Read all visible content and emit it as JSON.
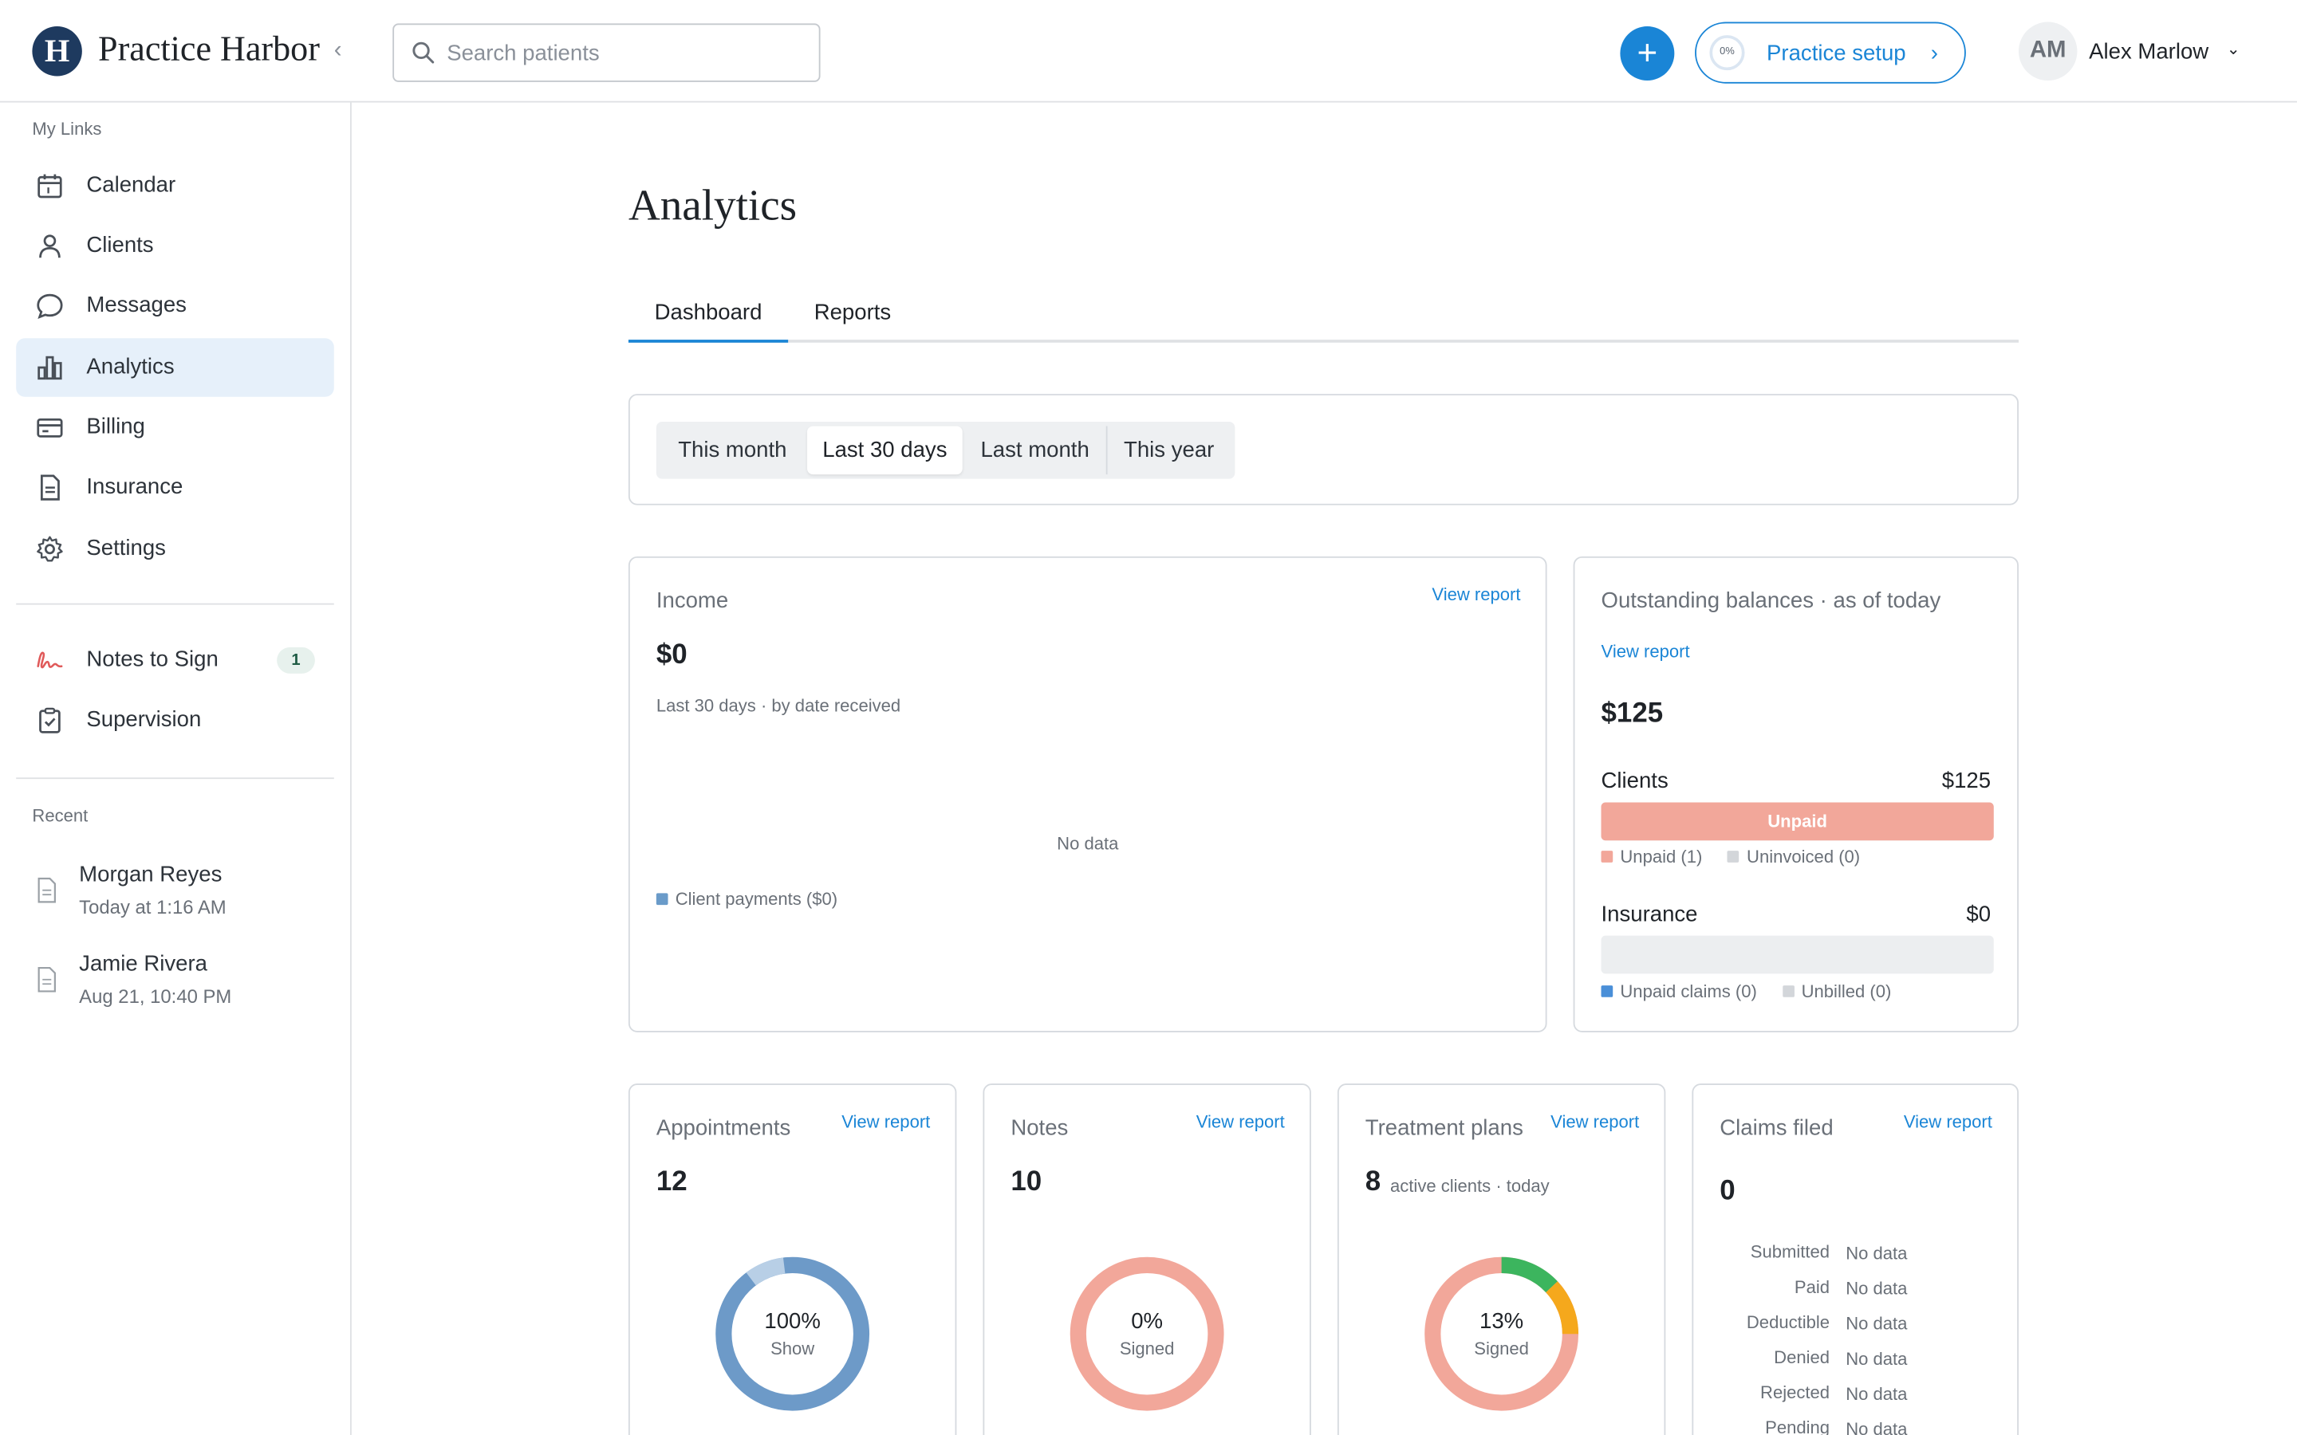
{
  "app": {
    "brand": "Practice Harbor",
    "logo_letter": "H",
    "collapse_glyph": "‹",
    "search_placeholder": "Search patients",
    "plus_glyph": "+",
    "setup_progress": "0%",
    "setup_label": "Practice setup",
    "setup_chevron": "›",
    "user_initials": "AM",
    "user_name": "Alex Marlow",
    "user_chevron": "⌄"
  },
  "sidebar": {
    "my_links_label": "My Links",
    "items": [
      {
        "label": "Calendar",
        "icon": "calendar-icon"
      },
      {
        "label": "Clients",
        "icon": "person-icon"
      },
      {
        "label": "Messages",
        "icon": "chat-icon"
      },
      {
        "label": "Analytics",
        "icon": "bar-chart-icon",
        "active": true
      },
      {
        "label": "Billing",
        "icon": "card-icon"
      },
      {
        "label": "Insurance",
        "icon": "document-icon"
      },
      {
        "label": "Settings",
        "icon": "gear-icon"
      }
    ],
    "secondary": [
      {
        "label": "Notes to Sign",
        "icon": "signature-icon",
        "badge": "1"
      },
      {
        "label": "Supervision",
        "icon": "clipboard-check-icon"
      }
    ],
    "recent_label": "Recent",
    "recent": [
      {
        "name": "Morgan Reyes",
        "time": "Today at 1:16 AM"
      },
      {
        "name": "Jamie Rivera",
        "time": "Aug 21, 10:40 PM"
      }
    ]
  },
  "main": {
    "title": "Analytics",
    "tabs": [
      {
        "label": "Dashboard",
        "active": true
      },
      {
        "label": "Reports"
      }
    ],
    "ranges": [
      {
        "label": "This month"
      },
      {
        "label": "Last 30 days",
        "active": true
      },
      {
        "label": "Last month"
      },
      {
        "label": "This year"
      }
    ],
    "income": {
      "title": "Income",
      "view_report": "View report",
      "value": "$0",
      "subtitle": "Last 30 days · by date received",
      "empty": "No data",
      "legend": "Client payments ($0)",
      "legend_color": "#6a9bc9"
    },
    "balances": {
      "title": "Outstanding balances · as of today",
      "view_report": "View report",
      "value": "$125",
      "clients_label": "Clients",
      "clients_value": "$125",
      "clients_bar_label": "Unpaid",
      "clients_unpaid_fraction": 1.0,
      "clients_legend": [
        "Unpaid (1)",
        "Uninvoiced (0)"
      ],
      "insurance_label": "Insurance",
      "insurance_value": "$0",
      "insurance_legend": [
        "Unpaid claims (0)",
        "Unbilled (0)"
      ],
      "colors": {
        "unpaid": "#f2a79a",
        "uninvoiced": "#d3d6da",
        "unpaid_claims": "#4a8fd8",
        "unbilled": "#d3d6da"
      }
    },
    "appointments": {
      "title": "Appointments",
      "view_report": "View report",
      "value": "12",
      "pct": "100%",
      "pct_label": "Show",
      "fraction": 1.0,
      "color": "#6d9ac8",
      "accent": "#b8cfe6"
    },
    "notes": {
      "title": "Notes",
      "view_report": "View report",
      "value": "10",
      "pct": "0%",
      "pct_label": "Signed",
      "fraction": 0.0,
      "color": "#f2a79a"
    },
    "treatment": {
      "title": "Treatment plans",
      "view_report": "View report",
      "value": "8",
      "value_note": "active clients · today",
      "pct": "13%",
      "pct_label": "Signed",
      "signed_fraction": 0.13,
      "pending_fraction": 0.12,
      "colors": {
        "signed": "#3cb55e",
        "pending": "#f5a81c",
        "rest": "#f2a79a"
      }
    },
    "claims": {
      "title": "Claims filed",
      "view_report": "View report",
      "value": "0",
      "rows": [
        {
          "label": "Submitted",
          "value": "No data"
        },
        {
          "label": "Paid",
          "value": "No data"
        },
        {
          "label": "Deductible",
          "value": "No data"
        },
        {
          "label": "Denied",
          "value": "No data"
        },
        {
          "label": "Rejected",
          "value": "No data"
        },
        {
          "label": "Pending",
          "value": "No data"
        }
      ]
    }
  }
}
